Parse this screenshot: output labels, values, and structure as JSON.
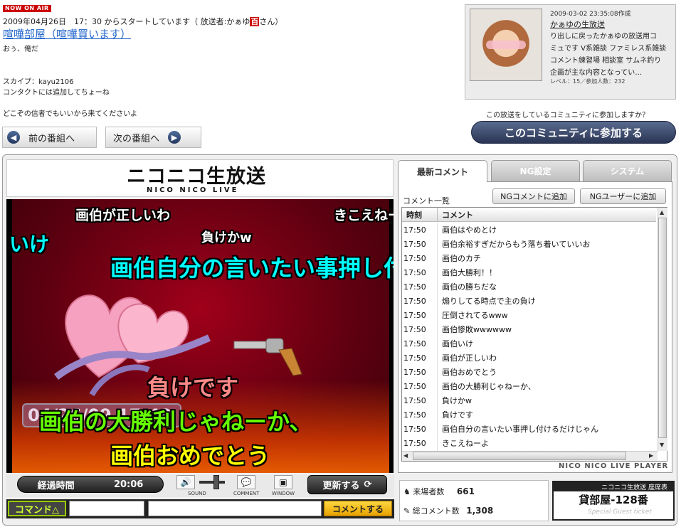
{
  "header": {
    "onair_badge": "NOW ON AIR",
    "start_info_before": "2009年04月26日　17：30 からスタートしています（ 放送者:かぁゆ",
    "host_badge": "百",
    "start_info_after": "さん）",
    "title": "喧嘩部屋（喧嘩買います）",
    "description": [
      "おぅ、俺だ",
      "",
      "",
      "スカイプ：kayu2106",
      "コンタクトには追加してちょーね",
      "",
      "",
      "どこぞの信者でもいいから来てくださいよ"
    ]
  },
  "community": {
    "created": "2009-03-02 23:35:08作成",
    "name": "かぁゆの生放送",
    "desc": [
      "り出しに戻ったかぁゆの放送用コ",
      "ミュです V系雑談 ファミレス系雑談",
      "コメント練習場 相談室 サムネ釣り",
      "企画が主な内容となってい…"
    ],
    "level": "レベル：15／参加人数：232",
    "join_question": "この放送をしているコミュニティに参加しますか？",
    "join_button": "このコミュニティに参加する"
  },
  "nav": {
    "prev": "前の番組へ",
    "next": "次の番組へ",
    "prev_icon": "◀",
    "next_icon": "▶"
  },
  "player": {
    "logo_main": "ニコニコ生放送",
    "logo_sub": "NICO NICO LIVE",
    "video_timestamp": "04/26/09 17:49",
    "overlay_comments": [
      {
        "text": "画伯が正しいわ",
        "color": "#ffffff"
      },
      {
        "text": "きこえねーよ",
        "color": "#ffffff"
      },
      {
        "text": "いけ",
        "color": "#00ffff"
      },
      {
        "text": "負けかw",
        "color": "#ffffff"
      },
      {
        "text": "画伯自分の言いたい事押し付けるだけじゃん",
        "color": "#00ffff"
      },
      {
        "text": "負けです",
        "color": "#ff8888"
      },
      {
        "text": "画伯の大勝利じゃねーか、",
        "color": "#66ff00"
      },
      {
        "text": "画伯おめでとう",
        "color": "#ffff00"
      }
    ],
    "elapsed_label": "経過時間",
    "elapsed_value": "20:06",
    "sound_label": "SOUND",
    "comment_label": "COMMENT",
    "window_label": "WINDOW",
    "refresh_button": "更新する",
    "command_button": "コマンド△",
    "command_value": "",
    "comment_value": "",
    "comment_submit": "コメントする"
  },
  "panel": {
    "tabs": [
      "最新コメント",
      "NG設定",
      "システム"
    ],
    "list_title": "コメント一覧",
    "ng_comment_button": "NGコメントに追加",
    "ng_user_button": "NGユーザーに追加",
    "col_time": "時刻",
    "col_comment": "コメント",
    "rows": [
      {
        "time": "17:50",
        "comment": "画伯はやめとけ"
      },
      {
        "time": "17:50",
        "comment": "画伯余裕すぎだからもう落ち着いていいお"
      },
      {
        "time": "17:50",
        "comment": "画伯のカチ"
      },
      {
        "time": "17:50",
        "comment": "画伯大勝利！！"
      },
      {
        "time": "17:50",
        "comment": "画伯の勝ちだな"
      },
      {
        "time": "17:50",
        "comment": "煽りしてる時点で主の負け"
      },
      {
        "time": "17:50",
        "comment": "圧倒されてるwww"
      },
      {
        "time": "17:50",
        "comment": "画伯惨敗wwwwww"
      },
      {
        "time": "17:50",
        "comment": "画伯いけ"
      },
      {
        "time": "17:50",
        "comment": "画伯が正しいわ"
      },
      {
        "time": "17:50",
        "comment": "画伯おめでとう"
      },
      {
        "time": "17:50",
        "comment": "画伯の大勝利じゃねーか、"
      },
      {
        "time": "17:50",
        "comment": "負けかw"
      },
      {
        "time": "17:50",
        "comment": "負けです"
      },
      {
        "time": "17:50",
        "comment": "画伯自分の言いたい事押し付けるだけじゃん"
      },
      {
        "time": "17:50",
        "comment": "きこえねーよ"
      }
    ],
    "player_label": "NICO NICO LIVE PLAYER"
  },
  "stats": {
    "visitors_label": "来場者数",
    "visitors": "661",
    "comments_label": "総コメント数",
    "comments": "1,308"
  },
  "seat": {
    "header": "ニコニコ生放送 座席表",
    "number": "貸部屋-128番",
    "ticket": "Special Guest ticket"
  }
}
